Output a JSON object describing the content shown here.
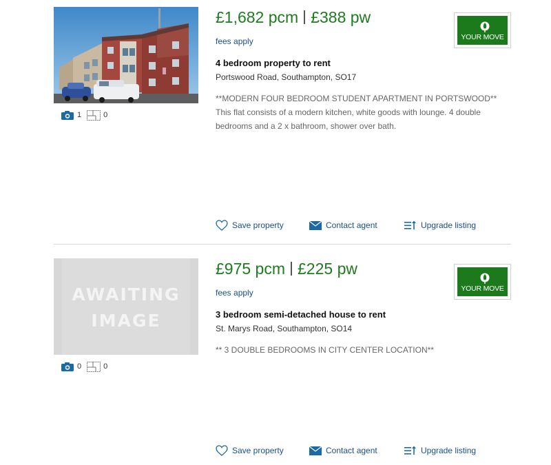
{
  "listings": [
    {
      "price": "£1,682 pcm",
      "price_week": "£388 pw",
      "fees": "fees apply",
      "title": "4 bedroom property to rent",
      "address": "Portswood Road, Southampton, SO17",
      "description": "**MODERN FOUR BEDROOM STUDENT APARTMENT IN PORTSWOOD** This flat consists of a modern kitchen, white goods with lounge. 4 double bedrooms and a 2 x bathroom, shower over bath.",
      "photo_count": "1",
      "floorplan_count": "0",
      "agent_logo_text": "YOUR MOVE",
      "actions": {
        "save": "Save property",
        "contact": "Contact agent",
        "upgrade": "Upgrade listing"
      }
    },
    {
      "price": "£975 pcm",
      "price_week": "£225 pw",
      "fees": "fees apply",
      "title": "3 bedroom semi-detached house to rent",
      "address": "St. Marys Road, Southampton, SO14",
      "description": "** 3 DOUBLE BEDROOMS IN CITY CENTER LOCATION**",
      "photo_count": "0",
      "floorplan_count": "0",
      "image_placeholder": "AWAITING IMAGE",
      "agent_logo_text": "YOUR MOVE",
      "actions": {
        "save": "Save property",
        "contact": "Contact agent",
        "upgrade": "Upgrade listing"
      }
    }
  ],
  "icons": {
    "camera": "camera-icon",
    "floorplan": "floorplan-icon",
    "save": "heart-icon",
    "contact": "envelope-icon",
    "upgrade": "upgrade-list-icon"
  },
  "colors": {
    "price": "#1f7b1f",
    "link": "#1a4f8a",
    "agent_green": "#1c7a1c",
    "icon_blue": "#1a6aa8"
  }
}
